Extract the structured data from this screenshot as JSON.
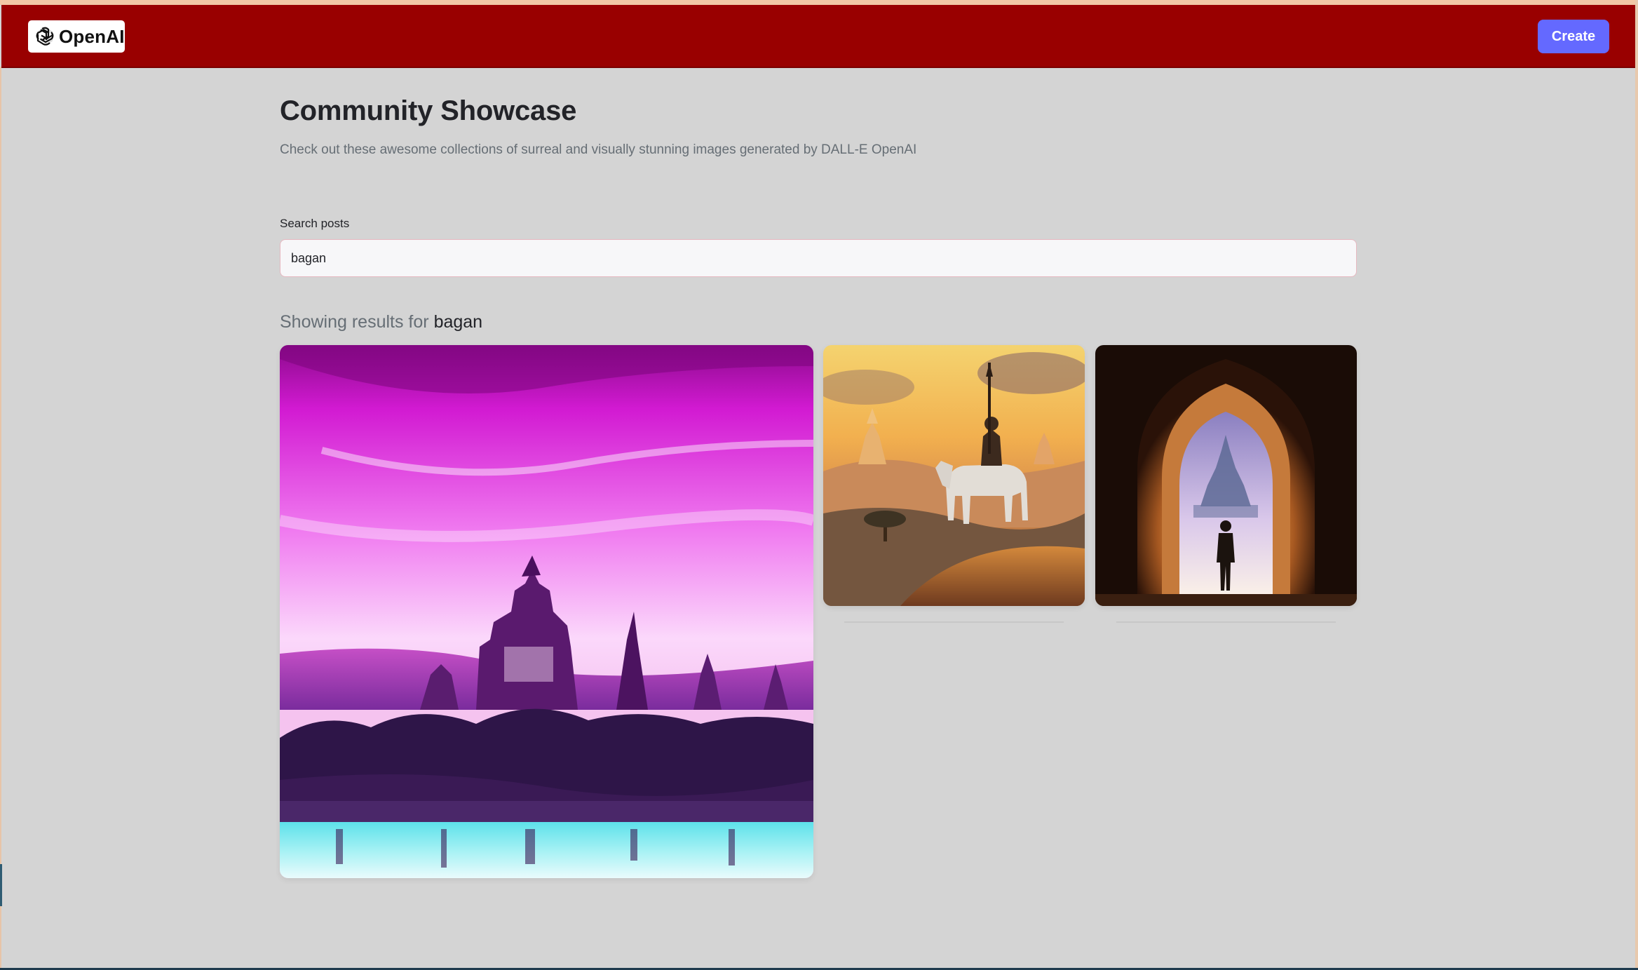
{
  "header": {
    "logo_text": "OpenAI",
    "logo_icon": "openai-logo-icon",
    "create_label": "Create",
    "colors": {
      "header_bg": "#990000",
      "create_bg": "#6469ff"
    }
  },
  "main": {
    "title": "Community Showcase",
    "subtitle": "Check out these awesome collections of surreal and visually stunning images generated by DALL-E OpenAI",
    "search": {
      "label": "Search posts",
      "value": "bagan"
    },
    "results": {
      "prefix": "Showing results for",
      "query": "bagan"
    },
    "cards": [
      {
        "icon": "pagoda-landscape-image"
      },
      {
        "icon": "horseman-temple-image"
      },
      {
        "icon": "arch-silhouette-image"
      }
    ]
  }
}
